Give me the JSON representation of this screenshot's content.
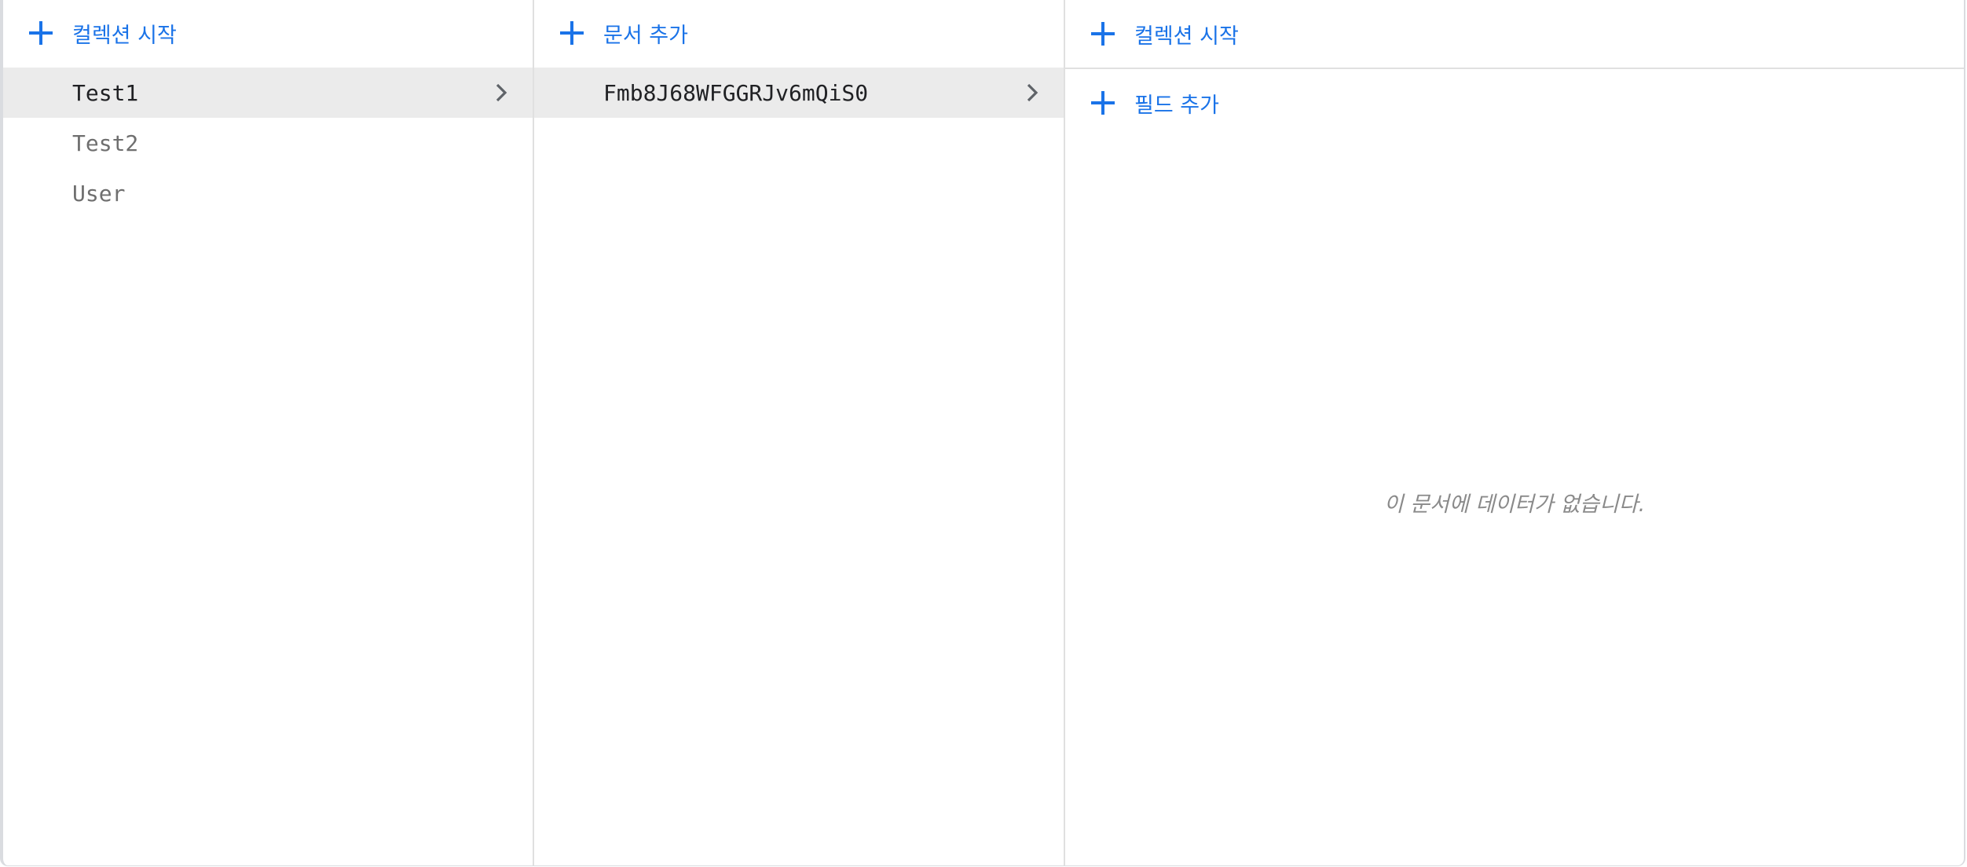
{
  "collections_panel": {
    "add_label": "컬렉션 시작",
    "items": [
      {
        "label": "Test1"
      },
      {
        "label": "Test2"
      },
      {
        "label": "User"
      }
    ]
  },
  "documents_panel": {
    "add_label": "문서 추가",
    "items": [
      {
        "label": "Fmb8J68WFGGRJv6mQiS0"
      }
    ]
  },
  "document_panel": {
    "add_collection_label": "컬렉션 시작",
    "add_field_label": "필드 추가",
    "empty_message": "이 문서에 데이터가 없습니다."
  },
  "colors": {
    "accent": "#1a73e8",
    "selected_bg": "#ebebeb",
    "divider": "#e0e0e0"
  },
  "icons": [
    "plus-icon",
    "chevron-right-icon"
  ]
}
